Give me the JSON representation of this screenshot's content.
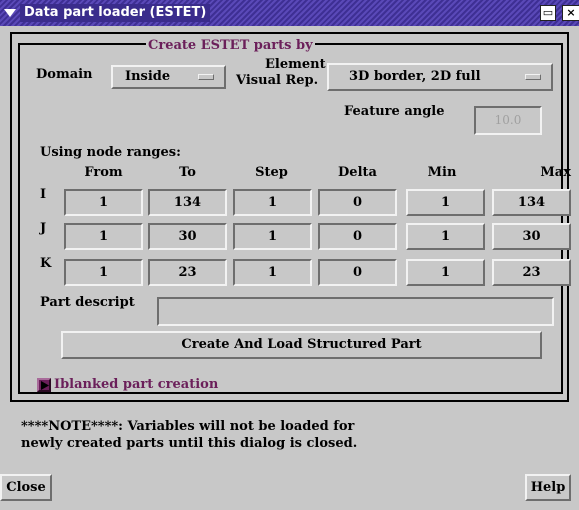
{
  "window": {
    "title": "Data part loader (ESTET)",
    "minimize_glyph": "▭",
    "close_glyph": "×"
  },
  "frame": {
    "legend": "Create ESTET parts by"
  },
  "domain": {
    "label": "Domain",
    "value": "Inside"
  },
  "element_visual": {
    "label_line1": "Element",
    "label_line2": "Visual Rep.",
    "value": "3D border, 2D full"
  },
  "feature_angle": {
    "label": "Feature angle",
    "value": "10.0"
  },
  "node_ranges": {
    "label": "Using node ranges:",
    "headers": [
      "From",
      "To",
      "Step",
      "Delta",
      "Min",
      "Max"
    ],
    "rows": [
      {
        "axis": "I",
        "from": "1",
        "to": "134",
        "step": "1",
        "delta": "0",
        "min": "1",
        "max": "134"
      },
      {
        "axis": "J",
        "from": "1",
        "to": "30",
        "step": "1",
        "delta": "0",
        "min": "1",
        "max": "30"
      },
      {
        "axis": "K",
        "from": "1",
        "to": "23",
        "step": "1",
        "delta": "0",
        "min": "1",
        "max": "23"
      }
    ]
  },
  "part_descript": {
    "label": "Part descript",
    "value": ""
  },
  "create_button": {
    "label": "Create And Load Structured Part"
  },
  "iblanked": {
    "label": "Iblanked part creation"
  },
  "note": {
    "line1": "****NOTE****: Variables will not be loaded for",
    "line2": "newly created parts until this dialog is closed."
  },
  "footer": {
    "close_label": "Close",
    "help_label": "Help"
  },
  "colors": {
    "accent": "#6b1f5a",
    "titlebar": "#3e2f94",
    "background": "#c8c8c8"
  }
}
